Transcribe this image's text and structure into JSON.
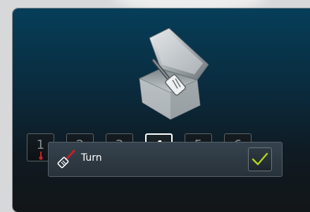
{
  "steps": [
    {
      "number": "1",
      "icon": "thermometer-icon",
      "state": "done"
    },
    {
      "number": "2",
      "icon": "steam-icon",
      "state": "pending"
    },
    {
      "number": "3",
      "icon": "pan-icon",
      "state": "pending"
    },
    {
      "number": "4",
      "icon": "drop-icon",
      "state": "current"
    },
    {
      "number": "5",
      "icon": "pan-icon",
      "state": "pending"
    },
    {
      "number": "6",
      "icon": "timer-icon",
      "state": "pending"
    }
  ],
  "action": {
    "label": "Turn",
    "icon": "spatula-icon",
    "confirm_icon": "checkmark-icon"
  },
  "colors": {
    "panel_top": "#063e59",
    "panel_bottom": "#121618",
    "accent_red": "#c0232b",
    "check_green": "#b4d21e"
  }
}
